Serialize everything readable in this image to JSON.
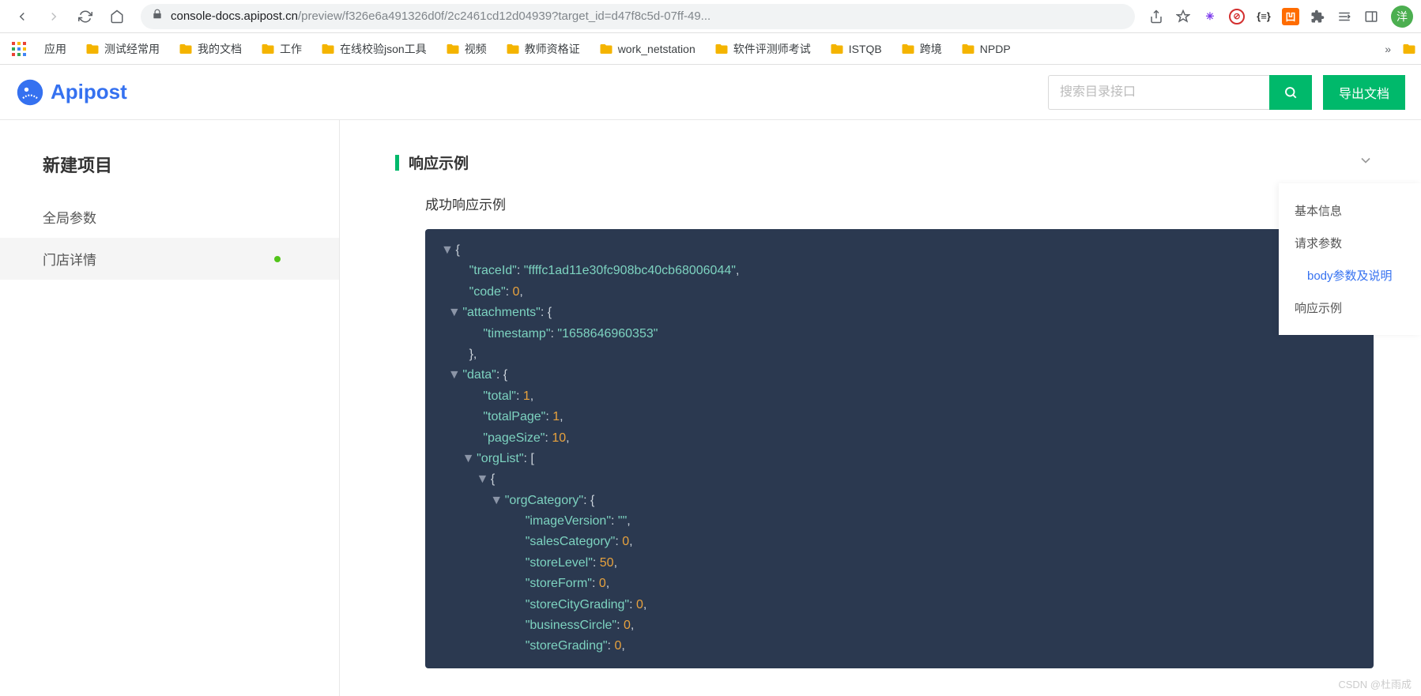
{
  "browser": {
    "url_host": "console-docs.apipost.cn",
    "url_path": "/preview/f326e6a491326d0f/2c2461cd12d04939?target_id=d47f8c5d-07ff-49...",
    "avatar_label": "洋"
  },
  "bookmarks": {
    "apps": "应用",
    "items": [
      "测试经常用",
      "我的文档",
      "工作",
      "在线校验json工具",
      "视频",
      "教师资格证",
      "work_netstation",
      "软件评测师考试",
      "ISTQB",
      "跨境",
      "NPDP"
    ],
    "more": "»"
  },
  "header": {
    "logo": "Apipost",
    "search_placeholder": "搜索目录接口",
    "export": "导出文档"
  },
  "sidebar": {
    "title": "新建项目",
    "items": [
      {
        "label": "全局参数",
        "active": false,
        "dot": false
      },
      {
        "label": "门店详情",
        "active": true,
        "dot": true
      }
    ]
  },
  "content": {
    "section_title": "响应示例",
    "sub_title": "成功响应示例"
  },
  "toc": {
    "items": [
      {
        "label": "基本信息",
        "sub": false
      },
      {
        "label": "请求参数",
        "sub": false
      },
      {
        "label": "body参数及说明",
        "sub": true
      },
      {
        "label": "响应示例",
        "sub": false
      }
    ]
  },
  "code": {
    "lines": [
      {
        "indent": 0,
        "toggle": "▼",
        "tokens": [
          {
            "t": "pp",
            "v": "{"
          }
        ]
      },
      {
        "indent": 2,
        "tokens": [
          {
            "t": "pk",
            "v": "\"traceId\""
          },
          {
            "t": "pp",
            "v": ": "
          },
          {
            "t": "ps",
            "v": "\"ffffc1ad11e30fc908bc40cb68006044\""
          },
          {
            "t": "pp",
            "v": ","
          }
        ]
      },
      {
        "indent": 2,
        "tokens": [
          {
            "t": "pk",
            "v": "\"code\""
          },
          {
            "t": "pp",
            "v": ": "
          },
          {
            "t": "pn",
            "v": "0"
          },
          {
            "t": "pp",
            "v": ","
          }
        ]
      },
      {
        "indent": 1,
        "toggle": "▼",
        "tokens": [
          {
            "t": "pk",
            "v": "\"attachments\""
          },
          {
            "t": "pp",
            "v": ": {"
          }
        ]
      },
      {
        "indent": 3,
        "tokens": [
          {
            "t": "pk",
            "v": "\"timestamp\""
          },
          {
            "t": "pp",
            "v": ": "
          },
          {
            "t": "ps",
            "v": "\"1658646960353\""
          }
        ]
      },
      {
        "indent": 2,
        "tokens": [
          {
            "t": "pp",
            "v": "},"
          }
        ]
      },
      {
        "indent": 1,
        "toggle": "▼",
        "tokens": [
          {
            "t": "pk",
            "v": "\"data\""
          },
          {
            "t": "pp",
            "v": ": {"
          }
        ]
      },
      {
        "indent": 3,
        "tokens": [
          {
            "t": "pk",
            "v": "\"total\""
          },
          {
            "t": "pp",
            "v": ": "
          },
          {
            "t": "pn",
            "v": "1"
          },
          {
            "t": "pp",
            "v": ","
          }
        ]
      },
      {
        "indent": 3,
        "tokens": [
          {
            "t": "pk",
            "v": "\"totalPage\""
          },
          {
            "t": "pp",
            "v": ": "
          },
          {
            "t": "pn",
            "v": "1"
          },
          {
            "t": "pp",
            "v": ","
          }
        ]
      },
      {
        "indent": 3,
        "tokens": [
          {
            "t": "pk",
            "v": "\"pageSize\""
          },
          {
            "t": "pp",
            "v": ": "
          },
          {
            "t": "pn",
            "v": "10"
          },
          {
            "t": "pp",
            "v": ","
          }
        ]
      },
      {
        "indent": 2,
        "toggle": "▼",
        "tokens": [
          {
            "t": "pk",
            "v": "\"orgList\""
          },
          {
            "t": "pp",
            "v": ": ["
          }
        ]
      },
      {
        "indent": 3,
        "toggle": "▼",
        "tokens": [
          {
            "t": "pp",
            "v": "{"
          }
        ]
      },
      {
        "indent": 4,
        "toggle": "▼",
        "tokens": [
          {
            "t": "pk",
            "v": "\"orgCategory\""
          },
          {
            "t": "pp",
            "v": ": {"
          }
        ]
      },
      {
        "indent": 6,
        "tokens": [
          {
            "t": "pk",
            "v": "\"imageVersion\""
          },
          {
            "t": "pp",
            "v": ": "
          },
          {
            "t": "ps",
            "v": "\"\""
          },
          {
            "t": "pp",
            "v": ","
          }
        ]
      },
      {
        "indent": 6,
        "tokens": [
          {
            "t": "pk",
            "v": "\"salesCategory\""
          },
          {
            "t": "pp",
            "v": ": "
          },
          {
            "t": "pn",
            "v": "0"
          },
          {
            "t": "pp",
            "v": ","
          }
        ]
      },
      {
        "indent": 6,
        "tokens": [
          {
            "t": "pk",
            "v": "\"storeLevel\""
          },
          {
            "t": "pp",
            "v": ": "
          },
          {
            "t": "pn",
            "v": "50"
          },
          {
            "t": "pp",
            "v": ","
          }
        ]
      },
      {
        "indent": 6,
        "tokens": [
          {
            "t": "pk",
            "v": "\"storeForm\""
          },
          {
            "t": "pp",
            "v": ": "
          },
          {
            "t": "pn",
            "v": "0"
          },
          {
            "t": "pp",
            "v": ","
          }
        ]
      },
      {
        "indent": 6,
        "tokens": [
          {
            "t": "pk",
            "v": "\"storeCityGrading\""
          },
          {
            "t": "pp",
            "v": ": "
          },
          {
            "t": "pn",
            "v": "0"
          },
          {
            "t": "pp",
            "v": ","
          }
        ]
      },
      {
        "indent": 6,
        "tokens": [
          {
            "t": "pk",
            "v": "\"businessCircle\""
          },
          {
            "t": "pp",
            "v": ": "
          },
          {
            "t": "pn",
            "v": "0"
          },
          {
            "t": "pp",
            "v": ","
          }
        ]
      },
      {
        "indent": 6,
        "tokens": [
          {
            "t": "pk",
            "v": "\"storeGrading\""
          },
          {
            "t": "pp",
            "v": ": "
          },
          {
            "t": "pn",
            "v": "0"
          },
          {
            "t": "pp",
            "v": ","
          }
        ]
      }
    ]
  },
  "watermark": "CSDN @杜雨成"
}
